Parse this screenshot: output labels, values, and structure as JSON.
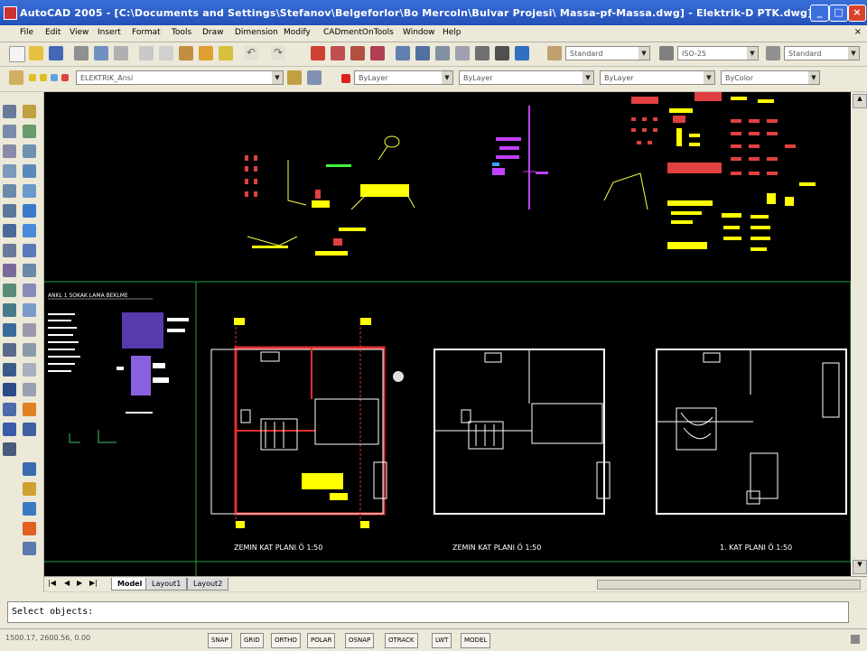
{
  "window": {
    "title": "AutoCAD 2005 - [C:\\Documents and Settings\\Stefanov\\Belgeforlor\\Bo Mercoln\\Bulvar Projesi\\ Massa-pf-Massa.dwg] - Elektrik-D PTK.dwg]"
  },
  "menu": [
    "File",
    "Edit",
    "View",
    "Insert",
    "Format",
    "Tools",
    "Draw",
    "Dimension",
    "Modify",
    "CADmentOnTools",
    "Window",
    "Help"
  ],
  "toolbar": {
    "textstyle": "Standard",
    "dimstyle": "ISO-25",
    "tablestyle": "Standard",
    "layer": "ELEKTRIK_Ansi",
    "color": "ByLayer",
    "linetype": "ByLayer",
    "lineweight": "ByLayer",
    "plotstyle": "ByColor"
  },
  "drawing": {
    "legend_title": "ANKL 1 SOKAK LAMA BEKLME",
    "plan_labels": [
      "ZEMIN KAT PLANI  Ö 1:50",
      "ZEMIN KAT PLANI  Ö 1:50",
      "1. KAT PLANI  Ö 1:50"
    ]
  },
  "tabs": [
    "Model",
    "Layout1",
    "Layout2"
  ],
  "command": {
    "prompt": "Select objects:"
  },
  "status": {
    "coords": "1500.17, 2600.56, 0.00",
    "buttons": [
      "SNAP",
      "GRID",
      "ORTHO",
      "POLAR",
      "OSNAP",
      "OTRACK",
      "LWT",
      "MODEL"
    ]
  },
  "colors": {
    "canvas": "#000000",
    "titlebar": "#2350b8",
    "plan_red": "#e03030",
    "text_yellow": "#ffff00",
    "accent_magenta": "#c040ff"
  }
}
